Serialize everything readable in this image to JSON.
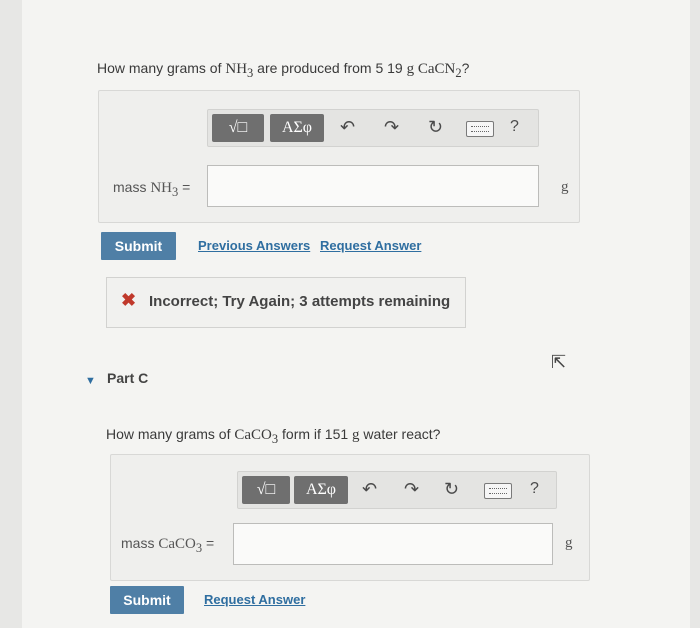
{
  "partB": {
    "question_pre": "How many grams of ",
    "question_chem": "NH",
    "question_sub": "3",
    "question_mid": " are produced from 5 19 ",
    "question_unit": "g",
    "question_chem2": " CaCN",
    "question_sub2": "2",
    "question_post": "?",
    "toolbar": {
      "templates": "√□",
      "symbols": "ΑΣφ",
      "help": "?"
    },
    "input_label_pre": "mass ",
    "input_label_chem": "NH",
    "input_label_sub": "3",
    "input_label_post": " =",
    "input_value": "",
    "unit": "g",
    "submit_label": "Submit",
    "previous_answers_label": "Previous Answers",
    "request_answer_label": "Request Answer",
    "feedback_text": "Incorrect; Try Again; 3 attempts remaining"
  },
  "partC": {
    "title": "Part C",
    "question_pre": "How many grams of ",
    "question_chem": "CaCO",
    "question_sub": "3",
    "question_mid": " form if 151 ",
    "question_unit": "g",
    "question_post": " water react?",
    "toolbar": {
      "templates": "√□",
      "symbols": "ΑΣφ",
      "help": "?"
    },
    "input_label_pre": "mass ",
    "input_label_chem": "CaCO",
    "input_label_sub": "3",
    "input_label_post": " =",
    "input_value": "",
    "unit": "g",
    "submit_label": "Submit",
    "request_answer_label": "Request Answer"
  },
  "icons": {
    "templates": "templates-icon",
    "symbols": "greek-symbols-icon",
    "undo": "undo-icon",
    "redo": "redo-icon",
    "reset": "reset-icon",
    "keyboard": "keyboard-icon",
    "help": "help-icon",
    "incorrect": "x-mark-icon",
    "collapse": "triangle-down-icon",
    "cursor": "mouse-cursor-icon"
  },
  "colors": {
    "accent": "#4f7fa6",
    "link": "#2f6ea0",
    "error": "#c0392b",
    "toolbar_button": "#6f6f6f"
  }
}
